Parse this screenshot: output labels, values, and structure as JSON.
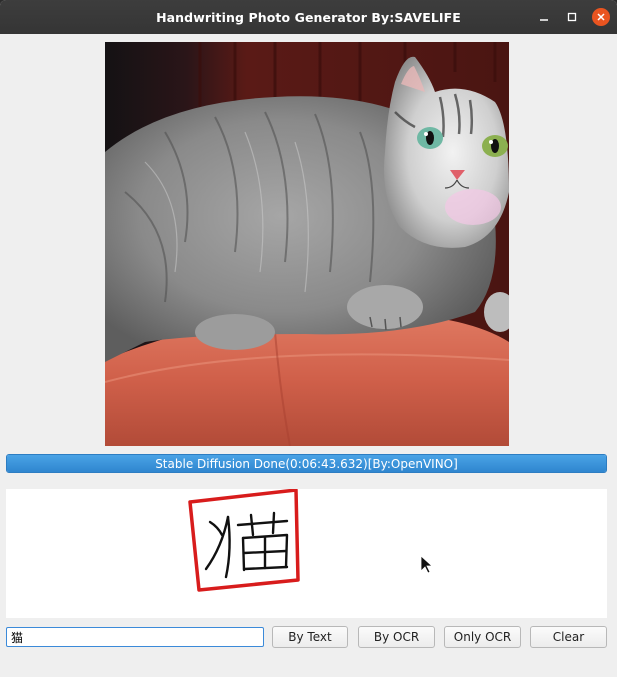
{
  "window": {
    "title": "Handwriting Photo Generator By:SAVELIFE",
    "minimize_icon": "minimize-icon",
    "maximize_icon": "maximize-icon",
    "close_icon": "close-icon",
    "close_color": "#e95420"
  },
  "image": {
    "subject": "generated-cat-photo",
    "colors": {
      "background": "#5a1a16",
      "cushion": "#d86a55",
      "fur": "#8e8e8e"
    }
  },
  "status": {
    "text": "Stable Diffusion Done(0:06:43.632)[By:OpenVINO]",
    "progress": 1.0,
    "color": "#2f86cf"
  },
  "canvas": {
    "handwriting_glyph": "猫",
    "stamp_color": "#d81c1c",
    "cursor_icon": "mouse-pointer-icon"
  },
  "controls": {
    "input_value": "猫",
    "by_text_label": "By Text",
    "by_ocr_label": "By OCR",
    "only_ocr_label": "Only OCR",
    "clear_label": "Clear"
  }
}
